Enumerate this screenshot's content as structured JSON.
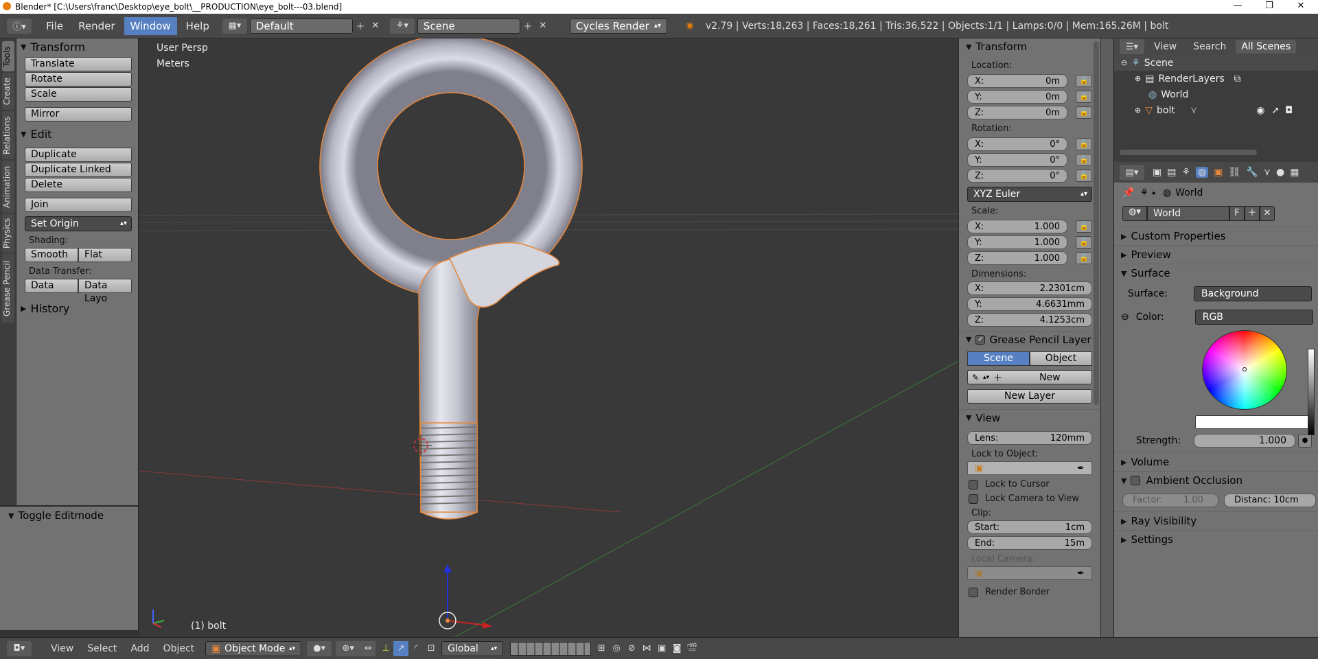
{
  "window": {
    "title": "Blender* [C:\\Users\\franc\\Desktop\\eye_bolt\\__PRODUCTION\\eye_bolt---03.blend]"
  },
  "topbar": {
    "menus": [
      "File",
      "Render",
      "Window",
      "Help"
    ],
    "active_menu": "Window",
    "layout": "Default",
    "scene": "Scene",
    "engine": "Cycles Render",
    "stats": "v2.79 | Verts:18,263 | Faces:18,261 | Tris:36,522 | Objects:1/1 | Lamps:0/0 | Mem:165.26M | bolt"
  },
  "tool_tabs": [
    "Tools",
    "Create",
    "Relations",
    "Animation",
    "Physics",
    "Grease Pencil"
  ],
  "tool_shelf": {
    "transform": {
      "title": "Transform",
      "buttons": [
        "Translate",
        "Rotate",
        "Scale",
        "Mirror"
      ]
    },
    "edit": {
      "title": "Edit",
      "buttons": [
        "Duplicate",
        "Duplicate Linked",
        "Delete",
        "Join"
      ],
      "set_origin": "Set Origin"
    },
    "shading": {
      "label": "Shading:",
      "smooth": "Smooth",
      "flat": "Flat"
    },
    "data_transfer": {
      "label": "Data Transfer:",
      "data": "Data",
      "data_layout": "Data Layo"
    },
    "history": "History",
    "toggle_editmode": "Toggle Editmode"
  },
  "viewport": {
    "view": "User Persp",
    "units": "Meters",
    "object_label": "(1) bolt"
  },
  "npanel": {
    "transform_title": "Transform",
    "location": {
      "label": "Location:",
      "x": "0m",
      "y": "0m",
      "z": "0m"
    },
    "rotation": {
      "label": "Rotation:",
      "x": "0°",
      "y": "0°",
      "z": "0°"
    },
    "rotation_mode": "XYZ Euler",
    "scale": {
      "label": "Scale:",
      "x": "1.000",
      "y": "1.000",
      "z": "1.000"
    },
    "dimensions": {
      "label": "Dimensions:",
      "x": "2.2301cm",
      "y": "4.6631mm",
      "z": "4.1253cm"
    },
    "axis": {
      "x": "X:",
      "y": "Y:",
      "z": "Z:"
    },
    "grease_pencil": {
      "title": "Grease Pencil Layer",
      "scene": "Scene",
      "object": "Object",
      "new": "New",
      "new_layer": "New Layer"
    },
    "view": {
      "title": "View",
      "lens_label": "Lens:",
      "lens": "120mm",
      "lock_to_object": "Lock to Object:",
      "lock_to_cursor": "Lock to Cursor",
      "lock_camera": "Lock Camera to View",
      "clip": "Clip:",
      "start_label": "Start:",
      "start": "1cm",
      "end_label": "End:",
      "end": "15m",
      "local_camera": "Local Camera:",
      "render_border": "Render Border"
    }
  },
  "outliner": {
    "view": "View",
    "search": "Search",
    "filter": "All Scenes",
    "rows": [
      "Scene",
      "RenderLayers",
      "World",
      "bolt"
    ]
  },
  "properties": {
    "breadcrumb": "World",
    "world_name": "World",
    "fake_user": "F",
    "panels": {
      "custom": "Custom Properties",
      "preview": "Preview",
      "surface": "Surface",
      "volume": "Volume",
      "ao": "Ambient Occlusion",
      "ray": "Ray Visibility",
      "settings": "Settings"
    },
    "surface_label": "Surface:",
    "surface_value": "Background",
    "color_label": "Color:",
    "color_mode": "RGB",
    "strength_label": "Strength:",
    "strength": "1.000",
    "factor": "Factor:",
    "factor_value": "1.00",
    "distance": "Distanc: 10cm"
  },
  "bottombar": {
    "menus": [
      "View",
      "Select",
      "Add",
      "Object"
    ],
    "mode": "Object Mode",
    "orientation": "Global"
  },
  "colors": {
    "accent": "#5680c2",
    "selection": "#e8883a",
    "panel": "#727272"
  }
}
